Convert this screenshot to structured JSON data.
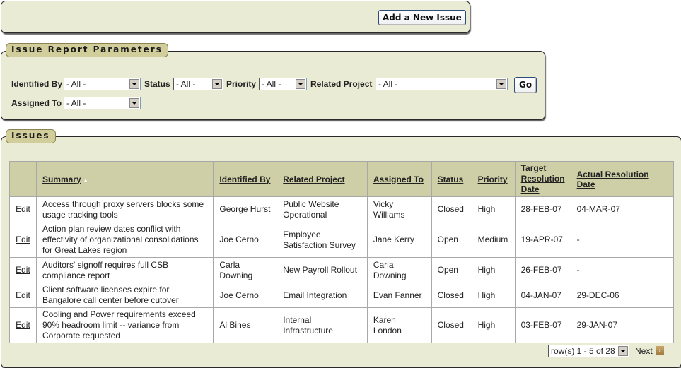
{
  "toolbar": {
    "add_issue_label": "Add a New Issue"
  },
  "parameters": {
    "legend": "Issue Report Parameters",
    "filters": [
      {
        "label": "Identified By",
        "value": "- All -"
      },
      {
        "label": "Status",
        "value": "- All -"
      },
      {
        "label": "Priority",
        "value": "- All -"
      },
      {
        "label": "Related Project",
        "value": "- All -"
      },
      {
        "label": "Assigned To",
        "value": "- All -"
      }
    ],
    "go_label": "Go"
  },
  "issues": {
    "legend": "Issues",
    "columns": [
      "",
      "Summary",
      "Identified By",
      "Related Project",
      "Assigned To",
      "Status",
      "Priority",
      "Target Resolution Date",
      "Actual Resolution Date"
    ],
    "sort_icon": "sort-ascending-icon",
    "edit_label": "Edit",
    "rows": [
      {
        "summary": "Access through proxy servers blocks some usage tracking tools",
        "identified_by": "George Hurst",
        "project": "Public Website Operational",
        "assigned_to": "Vicky Williams",
        "status": "Closed",
        "priority": "High",
        "target": "28-FEB-07",
        "actual": "04-MAR-07"
      },
      {
        "summary": "Action plan review dates conflict with effectivity of organizational consolidations for Great Lakes region",
        "identified_by": "Joe Cerno",
        "project": "Employee Satisfaction Survey",
        "assigned_to": "Jane Kerry",
        "status": "Open",
        "priority": "Medium",
        "target": "19-APR-07",
        "actual": "-"
      },
      {
        "summary": "Auditors' signoff requires full CSB compliance report",
        "identified_by": "Carla Downing",
        "project": "New Payroll Rollout",
        "assigned_to": "Carla Downing",
        "status": "Open",
        "priority": "High",
        "target": "26-FEB-07",
        "actual": "-"
      },
      {
        "summary": "Client software licenses expire for Bangalore call center before cutover",
        "identified_by": "Joe Cerno",
        "project": "Email Integration",
        "assigned_to": "Evan Fanner",
        "status": "Closed",
        "priority": "High",
        "target": "04-JAN-07",
        "actual": "29-DEC-06"
      },
      {
        "summary": "Cooling and Power requirements exceed 90% headroom limit -- variance from Corporate requested",
        "identified_by": "Al Bines",
        "project": "Internal Infrastructure",
        "assigned_to": "Karen London",
        "status": "Closed",
        "priority": "High",
        "target": "03-FEB-07",
        "actual": "29-JAN-07"
      }
    ],
    "pagination": {
      "range": "row(s) 1 - 5 of 28",
      "next_label": "Next"
    }
  }
}
